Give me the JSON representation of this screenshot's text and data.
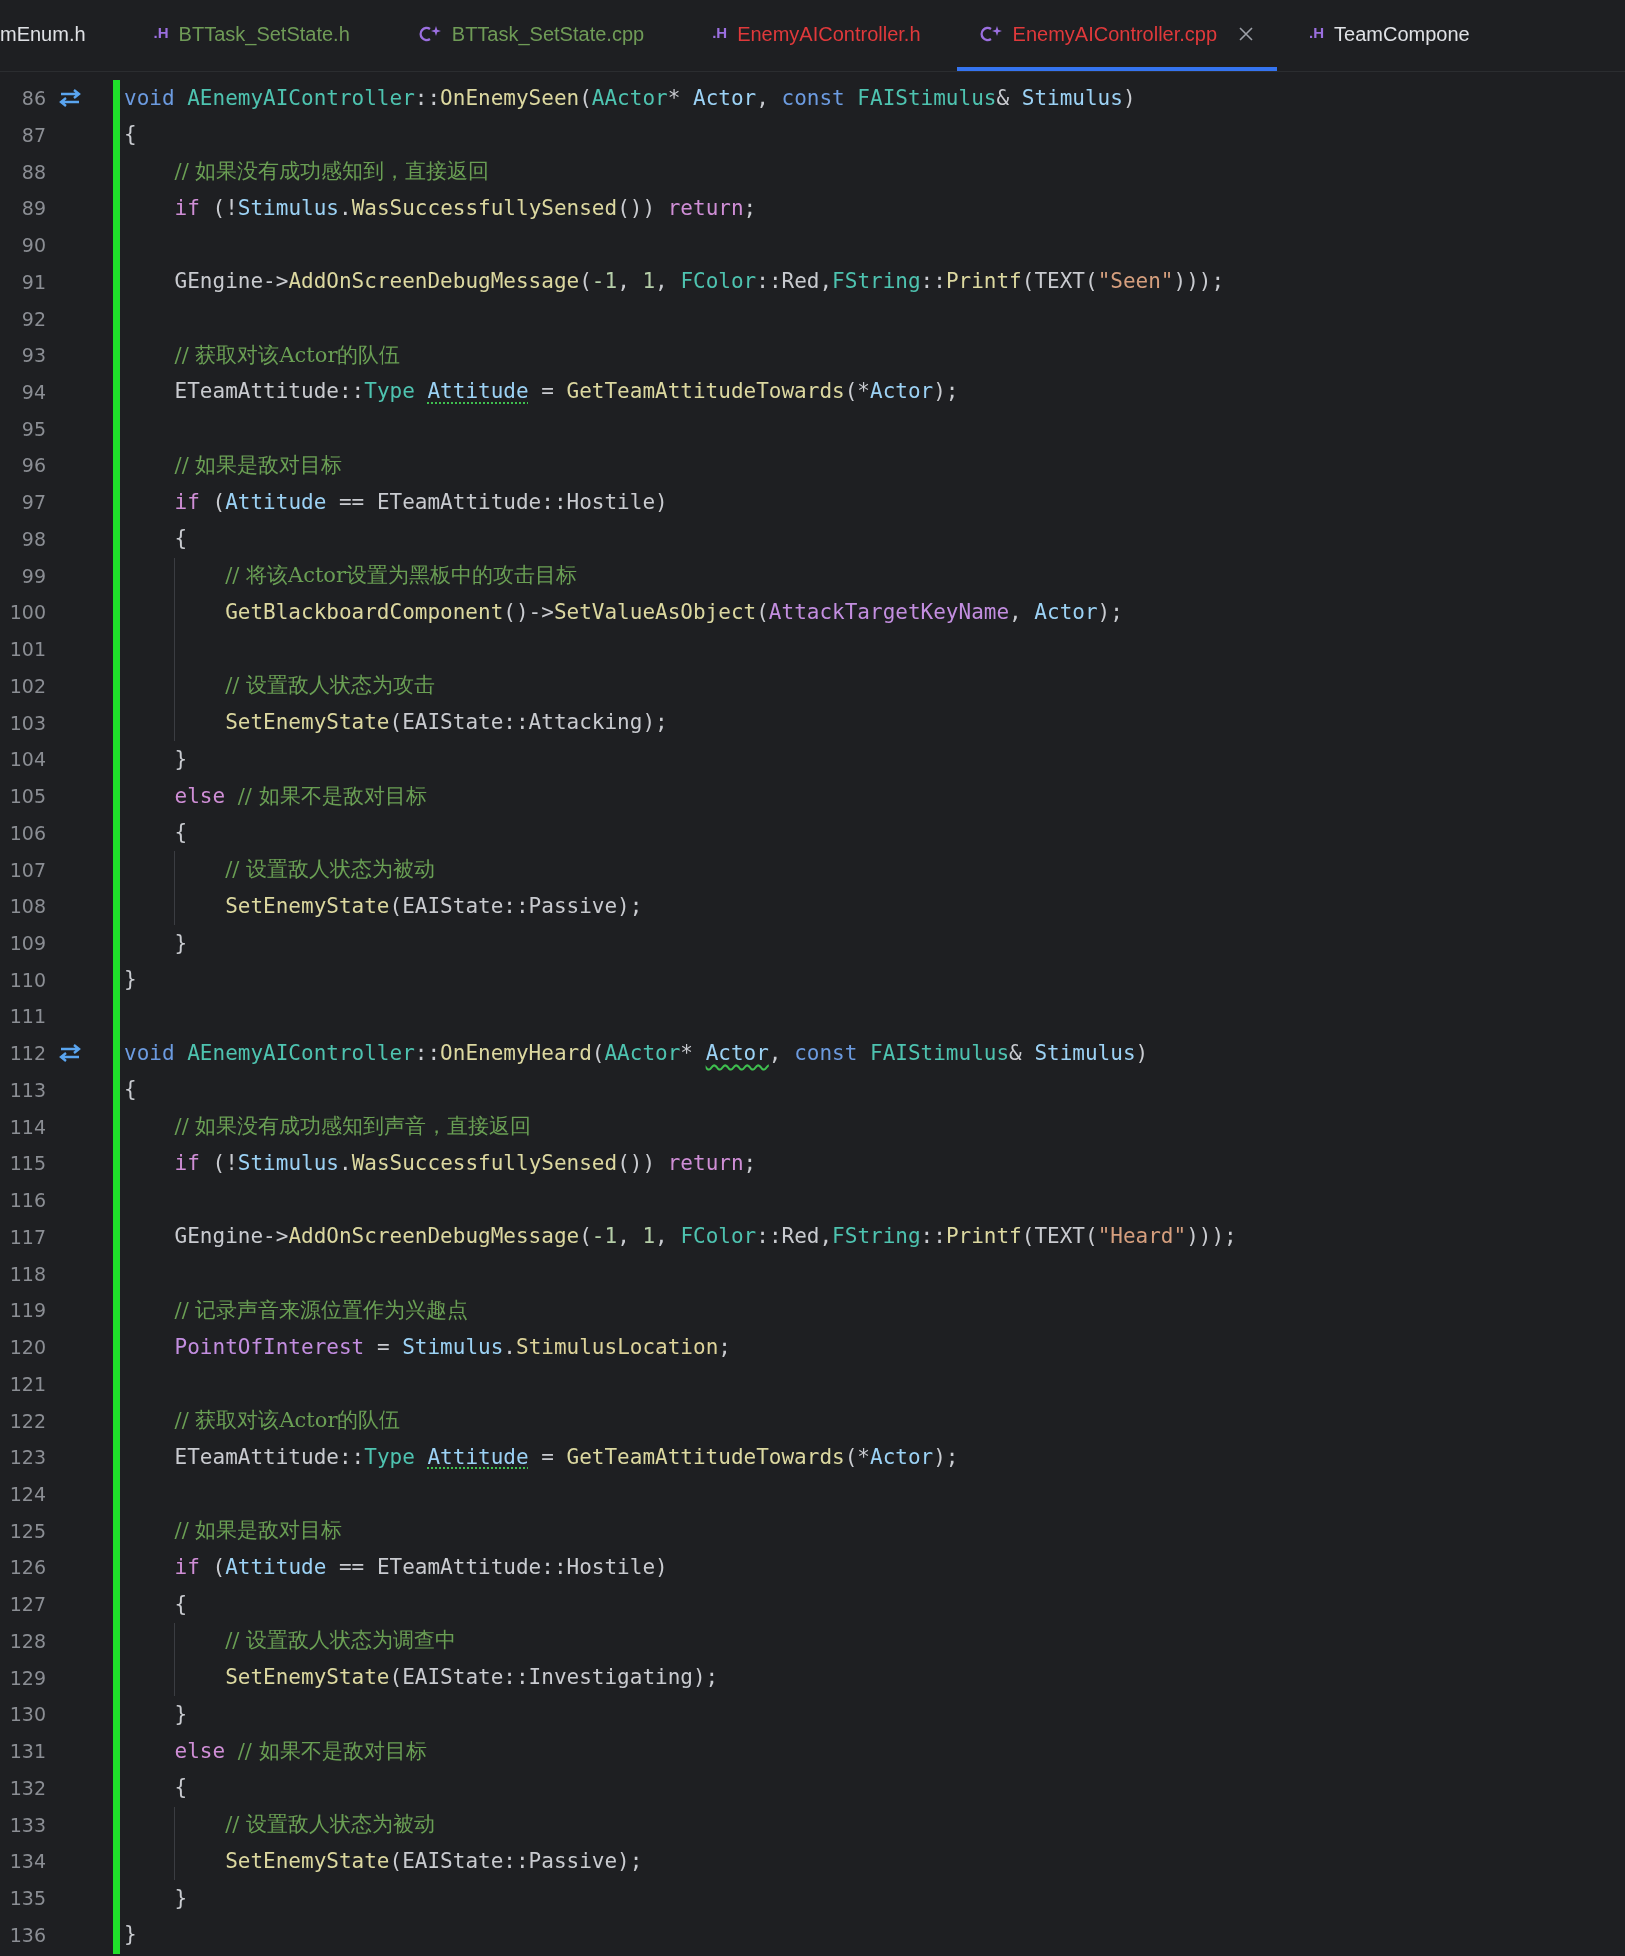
{
  "tabs": [
    {
      "label": "mEnum.h",
      "kind": "none",
      "color": "#dfe1e5",
      "selected": false
    },
    {
      "label": "BTTask_SetState.h",
      "kind": "header",
      "icon": ".H",
      "color": "#6f9b57",
      "selected": false
    },
    {
      "label": "BTTask_SetState.cpp",
      "kind": "source",
      "color": "#6f9b57",
      "selected": false
    },
    {
      "label": "EnemyAIController.h",
      "kind": "header",
      "icon": ".H",
      "color": "#e0393b",
      "selected": false
    },
    {
      "label": "EnemyAIController.cpp",
      "kind": "source",
      "color": "#e0393b",
      "selected": true
    },
    {
      "label": "TeamCompone",
      "kind": "header",
      "icon": ".H",
      "color": "#dfe1e5",
      "selected": false
    }
  ],
  "lines": [
    {
      "number": "86",
      "gutter_icon": true,
      "tokens": [
        {
          "t": "void ",
          "kind": "kw"
        },
        {
          "t": "AEnemyAIController",
          "kind": "type"
        },
        {
          "t": "::",
          "kind": "plain"
        },
        {
          "t": "OnEnemySeen",
          "kind": "fn"
        },
        {
          "t": "(",
          "kind": "plain"
        },
        {
          "t": "AActor",
          "kind": "type"
        },
        {
          "t": "* ",
          "kind": "plain"
        },
        {
          "t": "Actor",
          "kind": "param"
        },
        {
          "t": ", ",
          "kind": "plain"
        },
        {
          "t": "const ",
          "kind": "kw"
        },
        {
          "t": "FAIStimulus",
          "kind": "type"
        },
        {
          "t": "& ",
          "kind": "plain"
        },
        {
          "t": "Stimulus",
          "kind": "param"
        },
        {
          "t": ")",
          "kind": "plain"
        }
      ]
    },
    {
      "number": "87",
      "gutter_icon": false,
      "tokens": [
        {
          "t": "{",
          "kind": "plain"
        }
      ]
    },
    {
      "number": "88",
      "gutter_icon": false,
      "tokens": [
        {
          "t": "    // 如果没有成功感知到，直接返回",
          "kind": "cmt"
        }
      ]
    },
    {
      "number": "89",
      "gutter_icon": false,
      "tokens": [
        {
          "t": "    if",
          "kind": "ctl"
        },
        {
          "t": " (!",
          "kind": "plain"
        },
        {
          "t": "Stimulus",
          "kind": "param"
        },
        {
          "t": ".",
          "kind": "plain"
        },
        {
          "t": "WasSuccessfullySensed",
          "kind": "fn"
        },
        {
          "t": "()) ",
          "kind": "plain"
        },
        {
          "t": "return",
          "kind": "ctl"
        },
        {
          "t": ";",
          "kind": "plain"
        }
      ]
    },
    {
      "number": "90",
      "gutter_icon": false
    },
    {
      "number": "91",
      "gutter_icon": false,
      "tokens": [
        {
          "t": "    GEngine->",
          "kind": "plain"
        },
        {
          "t": "AddOnScreenDebugMessage",
          "kind": "fn"
        },
        {
          "t": "(",
          "kind": "plain"
        },
        {
          "t": "-1",
          "kind": "num"
        },
        {
          "t": ", ",
          "kind": "plain"
        },
        {
          "t": "1",
          "kind": "num"
        },
        {
          "t": ", ",
          "kind": "plain"
        },
        {
          "t": "FColor",
          "kind": "type"
        },
        {
          "t": "::Red,",
          "kind": "plain"
        },
        {
          "t": "FString",
          "kind": "type"
        },
        {
          "t": "::",
          "kind": "plain"
        },
        {
          "t": "Printf",
          "kind": "fn"
        },
        {
          "t": "(TEXT(",
          "kind": "plain"
        },
        {
          "t": "\"Seen\"",
          "kind": "str"
        },
        {
          "t": ")));",
          "kind": "plain"
        }
      ]
    },
    {
      "number": "92",
      "gutter_icon": false
    },
    {
      "number": "93",
      "gutter_icon": false,
      "tokens": [
        {
          "t": "    // 获取对该Actor的队伍",
          "kind": "cmt"
        }
      ]
    },
    {
      "number": "94",
      "gutter_icon": false,
      "tokens": [
        {
          "t": "    ETeamAttitude::",
          "kind": "plain"
        },
        {
          "t": "Type ",
          "kind": "type"
        },
        {
          "t": "Attitude",
          "kind": "var_hint"
        },
        {
          "t": " = ",
          "kind": "plain"
        },
        {
          "t": "GetTeamAttitudeTowards",
          "kind": "fn"
        },
        {
          "t": "(*",
          "kind": "plain"
        },
        {
          "t": "Actor",
          "kind": "param"
        },
        {
          "t": ");",
          "kind": "plain"
        }
      ]
    },
    {
      "number": "95",
      "gutter_icon": false
    },
    {
      "number": "96",
      "gutter_icon": false,
      "tokens": [
        {
          "t": "    // 如果是敌对目标",
          "kind": "cmt"
        }
      ]
    },
    {
      "number": "97",
      "gutter_icon": false,
      "tokens": [
        {
          "t": "    if",
          "kind": "ctl"
        },
        {
          "t": " (",
          "kind": "plain"
        },
        {
          "t": "Attitude",
          "kind": "var"
        },
        {
          "t": " == ETeamAttitude::Hostile)",
          "kind": "plain"
        }
      ]
    },
    {
      "number": "98",
      "gutter_icon": false,
      "tokens": [
        {
          "t": "    {",
          "kind": "plain"
        }
      ]
    },
    {
      "number": "99",
      "gutter_icon": false,
      "tokens": [
        {
          "t": "        // 将该Actor设置为黑板中的攻击目标",
          "kind": "cmt"
        }
      ]
    },
    {
      "number": "100",
      "gutter_icon": false,
      "tokens": [
        {
          "t": "        GetBlackboardComponent",
          "kind": "fn"
        },
        {
          "t": "()->",
          "kind": "plain"
        },
        {
          "t": "SetValueAsObject",
          "kind": "fn"
        },
        {
          "t": "(",
          "kind": "plain"
        },
        {
          "t": "AttackTargetKeyName",
          "kind": "member"
        },
        {
          "t": ", ",
          "kind": "plain"
        },
        {
          "t": "Actor",
          "kind": "param"
        },
        {
          "t": ");",
          "kind": "plain"
        }
      ]
    },
    {
      "number": "101",
      "gutter_icon": false
    },
    {
      "number": "102",
      "gutter_icon": false,
      "tokens": [
        {
          "t": "        // 设置敌人状态为攻击",
          "kind": "cmt"
        }
      ]
    },
    {
      "number": "103",
      "gutter_icon": false,
      "tokens": [
        {
          "t": "        SetEnemyState",
          "kind": "fn"
        },
        {
          "t": "(EAIState::Attacking);",
          "kind": "plain"
        }
      ]
    },
    {
      "number": "104",
      "gutter_icon": false,
      "tokens": [
        {
          "t": "    }",
          "kind": "plain"
        }
      ]
    },
    {
      "number": "105",
      "gutter_icon": false,
      "tokens": [
        {
          "t": "    else ",
          "kind": "ctl"
        },
        {
          "t": "// 如果不是敌对目标",
          "kind": "cmt"
        }
      ]
    },
    {
      "number": "106",
      "gutter_icon": false,
      "tokens": [
        {
          "t": "    {",
          "kind": "plain"
        }
      ]
    },
    {
      "number": "107",
      "gutter_icon": false,
      "tokens": [
        {
          "t": "        // 设置敌人状态为被动",
          "kind": "cmt"
        }
      ]
    },
    {
      "number": "108",
      "gutter_icon": false,
      "tokens": [
        {
          "t": "        SetEnemyState",
          "kind": "fn"
        },
        {
          "t": "(EAIState::Passive);",
          "kind": "plain"
        }
      ]
    },
    {
      "number": "109",
      "gutter_icon": false,
      "tokens": [
        {
          "t": "    }",
          "kind": "plain"
        }
      ]
    },
    {
      "number": "110",
      "gutter_icon": false,
      "tokens": [
        {
          "t": "}",
          "kind": "plain"
        }
      ]
    },
    {
      "number": "111",
      "gutter_icon": false
    },
    {
      "number": "112",
      "gutter_icon": true,
      "tokens": [
        {
          "t": "void ",
          "kind": "kw"
        },
        {
          "t": "AEnemyAIController",
          "kind": "type"
        },
        {
          "t": "::",
          "kind": "plain"
        },
        {
          "t": "OnEnemyHeard",
          "kind": "fn"
        },
        {
          "t": "(",
          "kind": "plain"
        },
        {
          "t": "AActor",
          "kind": "type"
        },
        {
          "t": "* ",
          "kind": "plain"
        },
        {
          "t": "Actor",
          "kind": "param_warn"
        },
        {
          "t": ", ",
          "kind": "plain"
        },
        {
          "t": "const ",
          "kind": "kw"
        },
        {
          "t": "FAIStimulus",
          "kind": "type"
        },
        {
          "t": "& ",
          "kind": "plain"
        },
        {
          "t": "Stimulus",
          "kind": "param"
        },
        {
          "t": ")",
          "kind": "plain"
        }
      ]
    },
    {
      "number": "113",
      "gutter_icon": false,
      "tokens": [
        {
          "t": "{",
          "kind": "plain"
        }
      ]
    },
    {
      "number": "114",
      "gutter_icon": false,
      "tokens": [
        {
          "t": "    // 如果没有成功感知到声音，直接返回",
          "kind": "cmt"
        }
      ]
    },
    {
      "number": "115",
      "gutter_icon": false,
      "tokens": [
        {
          "t": "    if",
          "kind": "ctl"
        },
        {
          "t": " (!",
          "kind": "plain"
        },
        {
          "t": "Stimulus",
          "kind": "param"
        },
        {
          "t": ".",
          "kind": "plain"
        },
        {
          "t": "WasSuccessfullySensed",
          "kind": "fn"
        },
        {
          "t": "()) ",
          "kind": "plain"
        },
        {
          "t": "return",
          "kind": "ctl"
        },
        {
          "t": ";",
          "kind": "plain"
        }
      ]
    },
    {
      "number": "116",
      "gutter_icon": false
    },
    {
      "number": "117",
      "gutter_icon": false,
      "tokens": [
        {
          "t": "    GEngine->",
          "kind": "plain"
        },
        {
          "t": "AddOnScreenDebugMessage",
          "kind": "fn"
        },
        {
          "t": "(",
          "kind": "plain"
        },
        {
          "t": "-1",
          "kind": "num"
        },
        {
          "t": ", ",
          "kind": "plain"
        },
        {
          "t": "1",
          "kind": "num"
        },
        {
          "t": ", ",
          "kind": "plain"
        },
        {
          "t": "FColor",
          "kind": "type"
        },
        {
          "t": "::Red,",
          "kind": "plain"
        },
        {
          "t": "FString",
          "kind": "type"
        },
        {
          "t": "::",
          "kind": "plain"
        },
        {
          "t": "Printf",
          "kind": "fn"
        },
        {
          "t": "(TEXT(",
          "kind": "plain"
        },
        {
          "t": "\"Heard\"",
          "kind": "str"
        },
        {
          "t": ")));",
          "kind": "plain"
        }
      ]
    },
    {
      "number": "118",
      "gutter_icon": false
    },
    {
      "number": "119",
      "gutter_icon": false,
      "tokens": [
        {
          "t": "    // 记录声音来源位置作为兴趣点",
          "kind": "cmt"
        }
      ]
    },
    {
      "number": "120",
      "gutter_icon": false,
      "tokens": [
        {
          "t": "    PointOfInterest",
          "kind": "member"
        },
        {
          "t": " = ",
          "kind": "plain"
        },
        {
          "t": "Stimulus",
          "kind": "param"
        },
        {
          "t": ".",
          "kind": "plain"
        },
        {
          "t": "StimulusLocation",
          "kind": "field"
        },
        {
          "t": ";",
          "kind": "plain"
        }
      ]
    },
    {
      "number": "121",
      "gutter_icon": false
    },
    {
      "number": "122",
      "gutter_icon": false,
      "tokens": [
        {
          "t": "    // 获取对该Actor的队伍",
          "kind": "cmt"
        }
      ]
    },
    {
      "number": "123",
      "gutter_icon": false,
      "tokens": [
        {
          "t": "    ETeamAttitude::",
          "kind": "plain"
        },
        {
          "t": "Type ",
          "kind": "type"
        },
        {
          "t": "Attitude",
          "kind": "var_hint"
        },
        {
          "t": " = ",
          "kind": "plain"
        },
        {
          "t": "GetTeamAttitudeTowards",
          "kind": "fn"
        },
        {
          "t": "(*",
          "kind": "plain"
        },
        {
          "t": "Actor",
          "kind": "param"
        },
        {
          "t": ");",
          "kind": "plain"
        }
      ]
    },
    {
      "number": "124",
      "gutter_icon": false
    },
    {
      "number": "125",
      "gutter_icon": false,
      "tokens": [
        {
          "t": "    // 如果是敌对目标",
          "kind": "cmt"
        }
      ]
    },
    {
      "number": "126",
      "gutter_icon": false,
      "tokens": [
        {
          "t": "    if",
          "kind": "ctl"
        },
        {
          "t": " (",
          "kind": "plain"
        },
        {
          "t": "Attitude",
          "kind": "var"
        },
        {
          "t": " == ETeamAttitude::Hostile)",
          "kind": "plain"
        }
      ]
    },
    {
      "number": "127",
      "gutter_icon": false,
      "tokens": [
        {
          "t": "    {",
          "kind": "plain"
        }
      ]
    },
    {
      "number": "128",
      "gutter_icon": false,
      "tokens": [
        {
          "t": "        // 设置敌人状态为调查中",
          "kind": "cmt"
        }
      ]
    },
    {
      "number": "129",
      "gutter_icon": false,
      "tokens": [
        {
          "t": "        SetEnemyState",
          "kind": "fn"
        },
        {
          "t": "(EAIState::Investigating);",
          "kind": "plain"
        }
      ]
    },
    {
      "number": "130",
      "gutter_icon": false,
      "tokens": [
        {
          "t": "    }",
          "kind": "plain"
        }
      ]
    },
    {
      "number": "131",
      "gutter_icon": false,
      "tokens": [
        {
          "t": "    else ",
          "kind": "ctl"
        },
        {
          "t": "// 如果不是敌对目标",
          "kind": "cmt"
        }
      ]
    },
    {
      "number": "132",
      "gutter_icon": false,
      "tokens": [
        {
          "t": "    {",
          "kind": "plain"
        }
      ]
    },
    {
      "number": "133",
      "gutter_icon": false,
      "tokens": [
        {
          "t": "        // 设置敌人状态为被动",
          "kind": "cmt"
        }
      ]
    },
    {
      "number": "134",
      "gutter_icon": false,
      "tokens": [
        {
          "t": "        SetEnemyState",
          "kind": "fn"
        },
        {
          "t": "(EAIState::Passive);",
          "kind": "plain"
        }
      ]
    },
    {
      "number": "135",
      "gutter_icon": false,
      "tokens": [
        {
          "t": "    }",
          "kind": "plain"
        }
      ]
    },
    {
      "number": "136",
      "gutter_icon": false,
      "tokens": [
        {
          "t": "}",
          "kind": "plain"
        }
      ]
    }
  ]
}
